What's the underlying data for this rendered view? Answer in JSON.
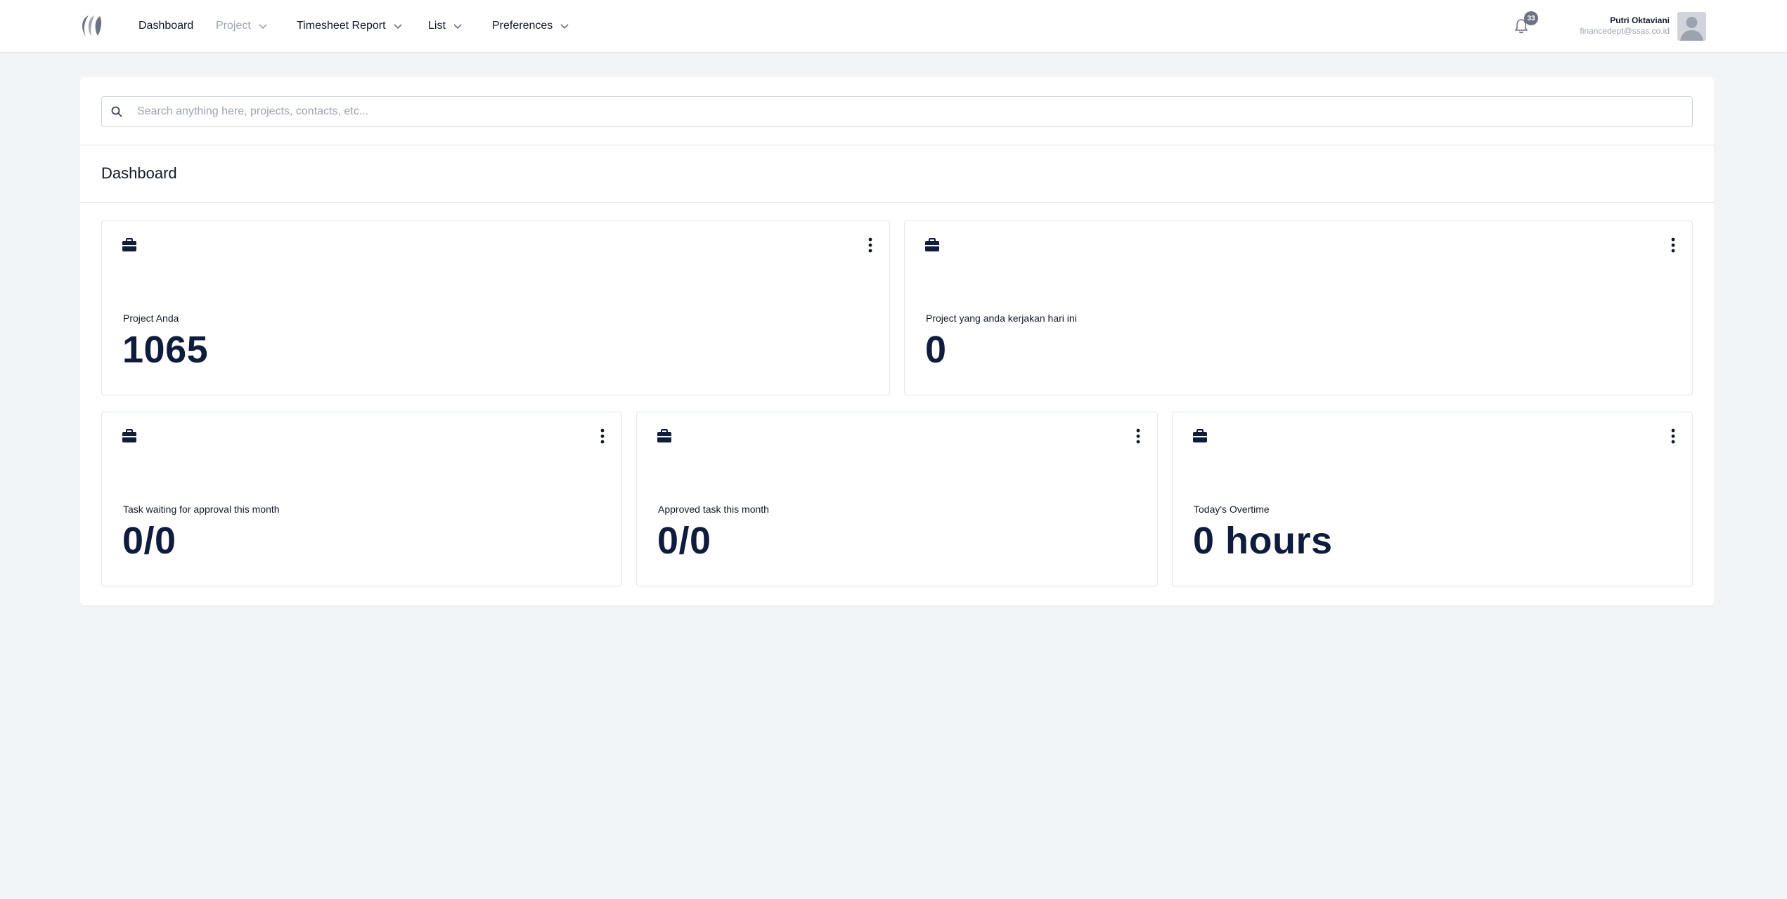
{
  "nav": {
    "items": [
      {
        "label": "Dashboard"
      },
      {
        "label": "Project"
      },
      {
        "label": "Timesheet Report"
      },
      {
        "label": "List"
      },
      {
        "label": "Preferences"
      }
    ],
    "notification_count": "33",
    "user": {
      "name": "Putri Oktaviani",
      "email": "financedept@ssas.co.id"
    }
  },
  "search": {
    "placeholder": "Search anything here, projects, contacts, etc...",
    "value": ""
  },
  "page": {
    "title": "Dashboard"
  },
  "cards": [
    {
      "label": "Project Anda",
      "value": "1065",
      "icon": "briefcase-icon"
    },
    {
      "label": "Project yang anda kerjakan hari ini",
      "value": "0",
      "icon": "briefcase-icon"
    },
    {
      "label": "Task waiting for approval this month",
      "value": "0/0",
      "icon": "briefcase-icon"
    },
    {
      "label": "Approved task this month",
      "value": "0/0",
      "icon": "briefcase-icon"
    },
    {
      "label": "Today's Overtime",
      "value": "0 hours",
      "icon": "briefcase-icon"
    }
  ],
  "colors": {
    "background": "#f2f5f8",
    "card_value": "#101c3d",
    "muted_text": "#9ca3af",
    "badge": "#6b7280"
  }
}
